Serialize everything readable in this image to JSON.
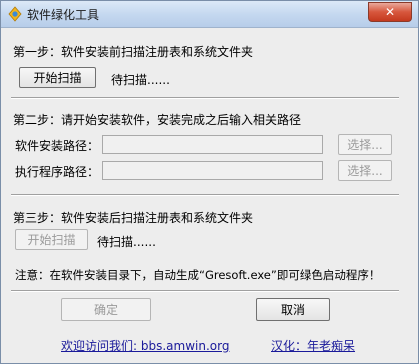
{
  "window": {
    "title": "软件绿化工具",
    "close_glyph": "✕"
  },
  "step1": {
    "label": "第一步：软件安装前扫描注册表和系统文件夹",
    "button": "开始扫描",
    "status": "待扫描......"
  },
  "step2": {
    "label": "第二步：请开始安装软件，安装完成之后输入相关路径",
    "install_path_label": "软件安装路径：",
    "install_path_value": "",
    "exe_path_label": "执行程序路径：",
    "exe_path_value": "",
    "browse_button": "选择..."
  },
  "step3": {
    "label": "第三步：软件安装后扫描注册表和系统文件夹",
    "button": "开始扫描",
    "status": "待扫描......"
  },
  "note": "注意：在软件安装目录下，自动生成“Gresoft.exe”即可绿色启动程序！",
  "buttons": {
    "ok": "确定",
    "cancel": "取消"
  },
  "footer": {
    "visit_text": "欢迎访问我们: bbs.amwin.org",
    "localized_text": "汉化：年老痴呆"
  },
  "colors": {
    "link": "#1a1a9a",
    "close": "#c4391e"
  }
}
